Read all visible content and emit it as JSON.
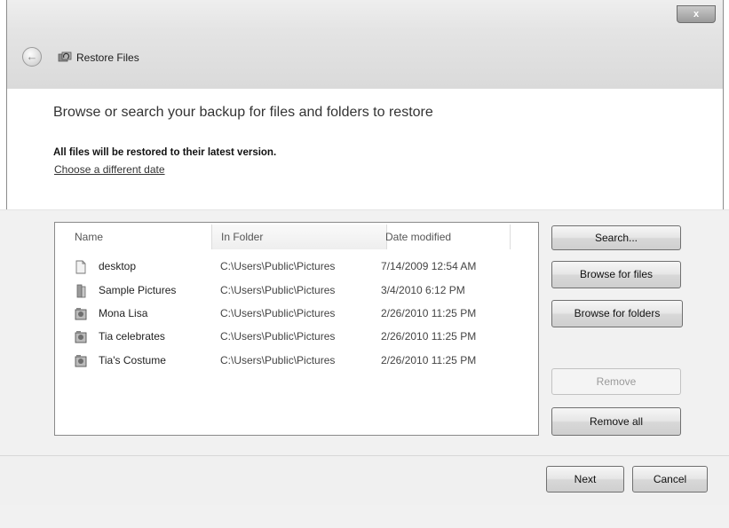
{
  "window": {
    "title": "Restore Files",
    "close_label": "x"
  },
  "header": {
    "heading": "Browse or search your backup for files and folders to restore",
    "note": "All files will be restored to their latest version.",
    "date_link": "Choose a different date"
  },
  "table": {
    "columns": [
      "Name",
      "In Folder",
      "Date modified"
    ],
    "rows": [
      {
        "name": "desktop",
        "folder": "C:\\Users\\Public\\Pictures",
        "date": "7/14/2009 12:54 AM",
        "icon": "file-icon"
      },
      {
        "name": "Sample Pictures",
        "folder": "C:\\Users\\Public\\Pictures",
        "date": "3/4/2010 6:12 PM",
        "icon": "folder-icon"
      },
      {
        "name": "Mona Lisa",
        "folder": "C:\\Users\\Public\\Pictures",
        "date": "2/26/2010 11:25 PM",
        "icon": "image-icon"
      },
      {
        "name": "Tia celebrates",
        "folder": "C:\\Users\\Public\\Pictures",
        "date": "2/26/2010 11:25 PM",
        "icon": "image-icon"
      },
      {
        "name": "Tia's Costume",
        "folder": "C:\\Users\\Public\\Pictures",
        "date": "2/26/2010 11:25 PM",
        "icon": "image-icon"
      }
    ]
  },
  "side_buttons": {
    "search": "Search...",
    "browse_files": "Browse for files",
    "browse_folders": "Browse for folders",
    "remove": "Remove",
    "remove_all": "Remove all"
  },
  "footer": {
    "next": "Next",
    "cancel": "Cancel"
  }
}
